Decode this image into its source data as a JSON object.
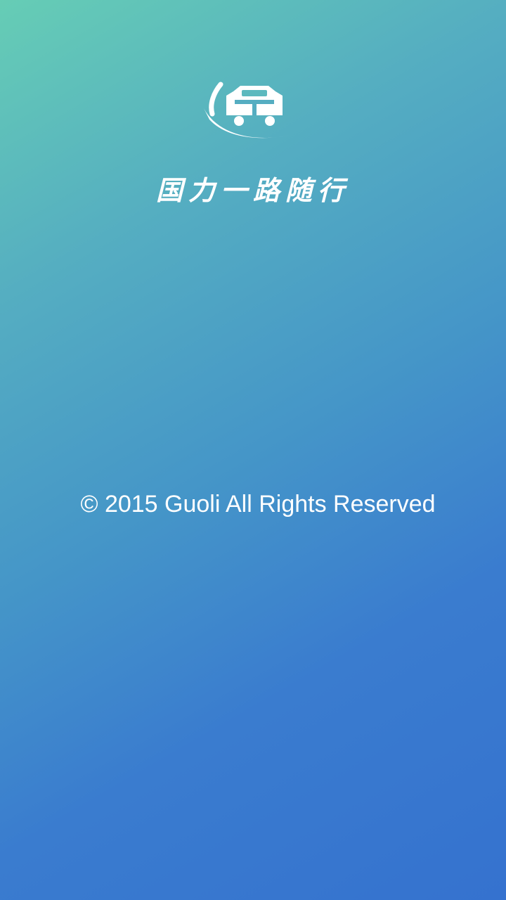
{
  "splash": {
    "logo_icon": "car-wave-logo-icon",
    "slogan": "国力一路随行",
    "copyright": "© 2015 Guoli All Rights Reserved"
  },
  "colors": {
    "gradient_top": "#66cdb5",
    "gradient_bottom": "#3572cf",
    "text": "#ffffff"
  }
}
